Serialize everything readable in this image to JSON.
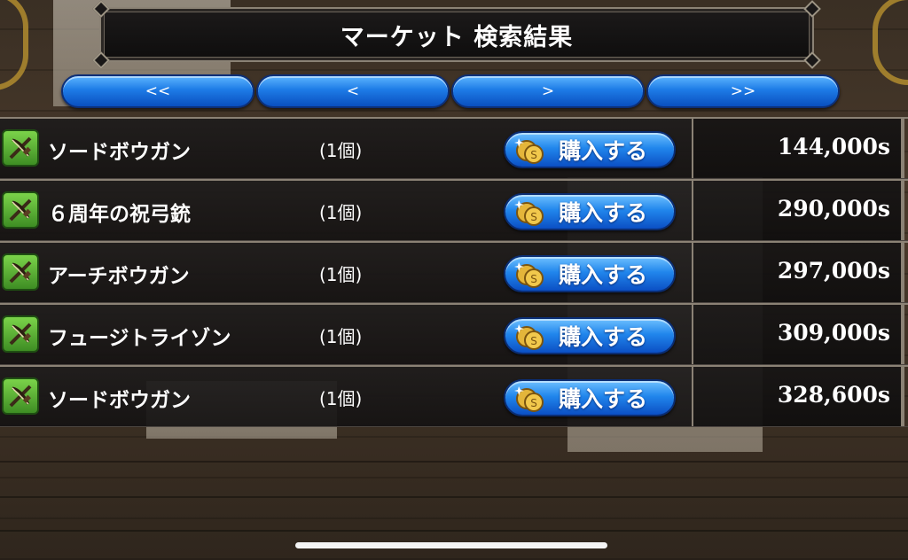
{
  "title": "マーケット 検索結果",
  "nav": {
    "first": "<<",
    "prev": "<",
    "next": ">",
    "last": ">>"
  },
  "buy_label": "購入する",
  "items": [
    {
      "name": "ソードボウガン",
      "qty": "(1個)",
      "price": "144,000s",
      "icon": "crossbow-icon"
    },
    {
      "name": "６周年の祝弓銃",
      "qty": "(1個)",
      "price": "290,000s",
      "icon": "crossbow-icon"
    },
    {
      "name": "アーチボウガン",
      "qty": "(1個)",
      "price": "297,000s",
      "icon": "crossbow-icon"
    },
    {
      "name": "フュージトライゾン",
      "qty": "(1個)",
      "price": "309,000s",
      "icon": "crossbow-icon"
    },
    {
      "name": "ソードボウガン",
      "qty": "(1個)",
      "price": "328,600s",
      "icon": "crossbow-icon"
    }
  ],
  "colors": {
    "button_blue": "#1d7be6",
    "panel_dark": "#1a1818",
    "border": "#8b8275",
    "icon_green": "#5cb13a"
  }
}
